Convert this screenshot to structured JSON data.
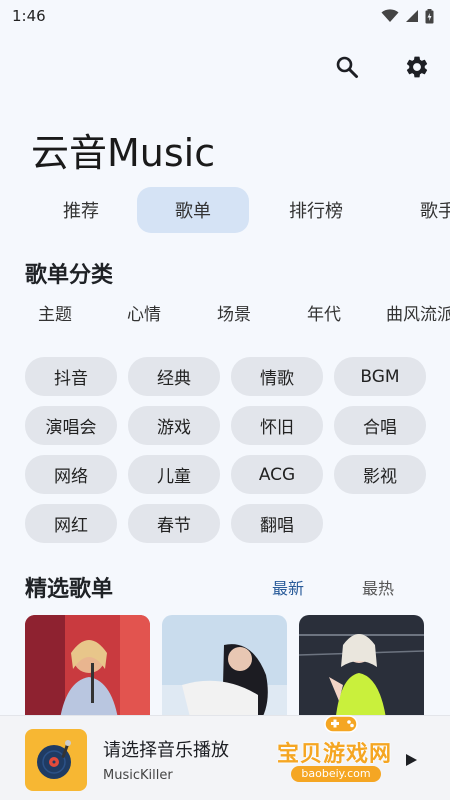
{
  "status_bar": {
    "time": "1:46"
  },
  "app": {
    "title": "云音Music"
  },
  "tabs": [
    {
      "label": "推荐"
    },
    {
      "label": "歌单"
    },
    {
      "label": "排行榜"
    },
    {
      "label": "歌手"
    }
  ],
  "active_tab": "歌单",
  "category_section": {
    "title": "歌单分类",
    "subcategories": [
      "主题",
      "心情",
      "场景",
      "年代",
      "曲风流派"
    ],
    "chips": [
      "抖音",
      "经典",
      "情歌",
      "BGM",
      "演唱会",
      "游戏",
      "怀旧",
      "合唱",
      "网络",
      "儿童",
      "ACG",
      "影视",
      "网红",
      "春节",
      "翻唱"
    ]
  },
  "featured_section": {
    "title": "精选歌单",
    "sort_latest": "最新",
    "sort_hottest": "最热",
    "active_sort": "最新"
  },
  "player": {
    "title": "请选择音乐播放",
    "subtitle": "MusicKiller"
  },
  "watermark": {
    "text": "宝贝游戏网",
    "url": "baobeiy.com"
  },
  "colors": {
    "background": "#f5f8fd",
    "active_tab_bg": "#d5e3f5",
    "chip_bg": "#e2e5eb",
    "accent": "#2a5c9a",
    "player_art": "#f7b733"
  },
  "icons": [
    "wifi-icon",
    "signal-icon",
    "battery-icon",
    "search-icon",
    "settings-gear-icon",
    "vinyl-record-icon"
  ]
}
